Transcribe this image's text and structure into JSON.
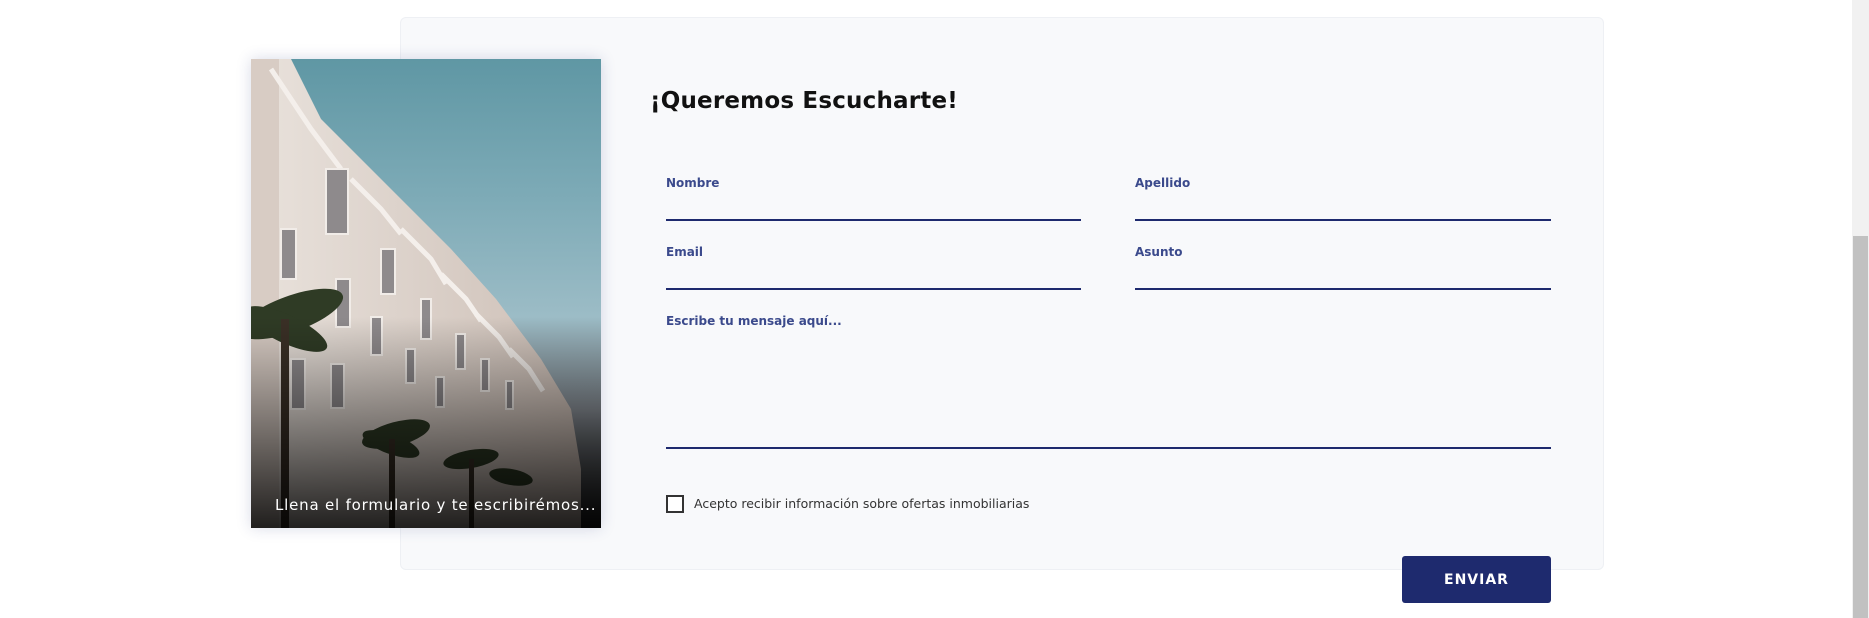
{
  "form": {
    "title": "¡Queremos Escucharte!",
    "fields": {
      "nombre": {
        "label": "Nombre",
        "value": ""
      },
      "apellido": {
        "label": "Apellido",
        "value": ""
      },
      "email": {
        "label": "Email",
        "value": ""
      },
      "asunto": {
        "label": "Asunto",
        "value": ""
      },
      "mensaje": {
        "label": "Escribe tu mensaje aquí...",
        "value": ""
      }
    },
    "consent": {
      "label": "Acepto recibir información sobre ofertas inmobiliarias",
      "checked": false
    },
    "submit_label": "ENVIAR"
  },
  "photo": {
    "caption": "Llena el formulario y te escribirémos..."
  },
  "colors": {
    "accent": "#1e2a6e",
    "label": "#3b4a8c",
    "card_bg": "#f8f9fb"
  }
}
